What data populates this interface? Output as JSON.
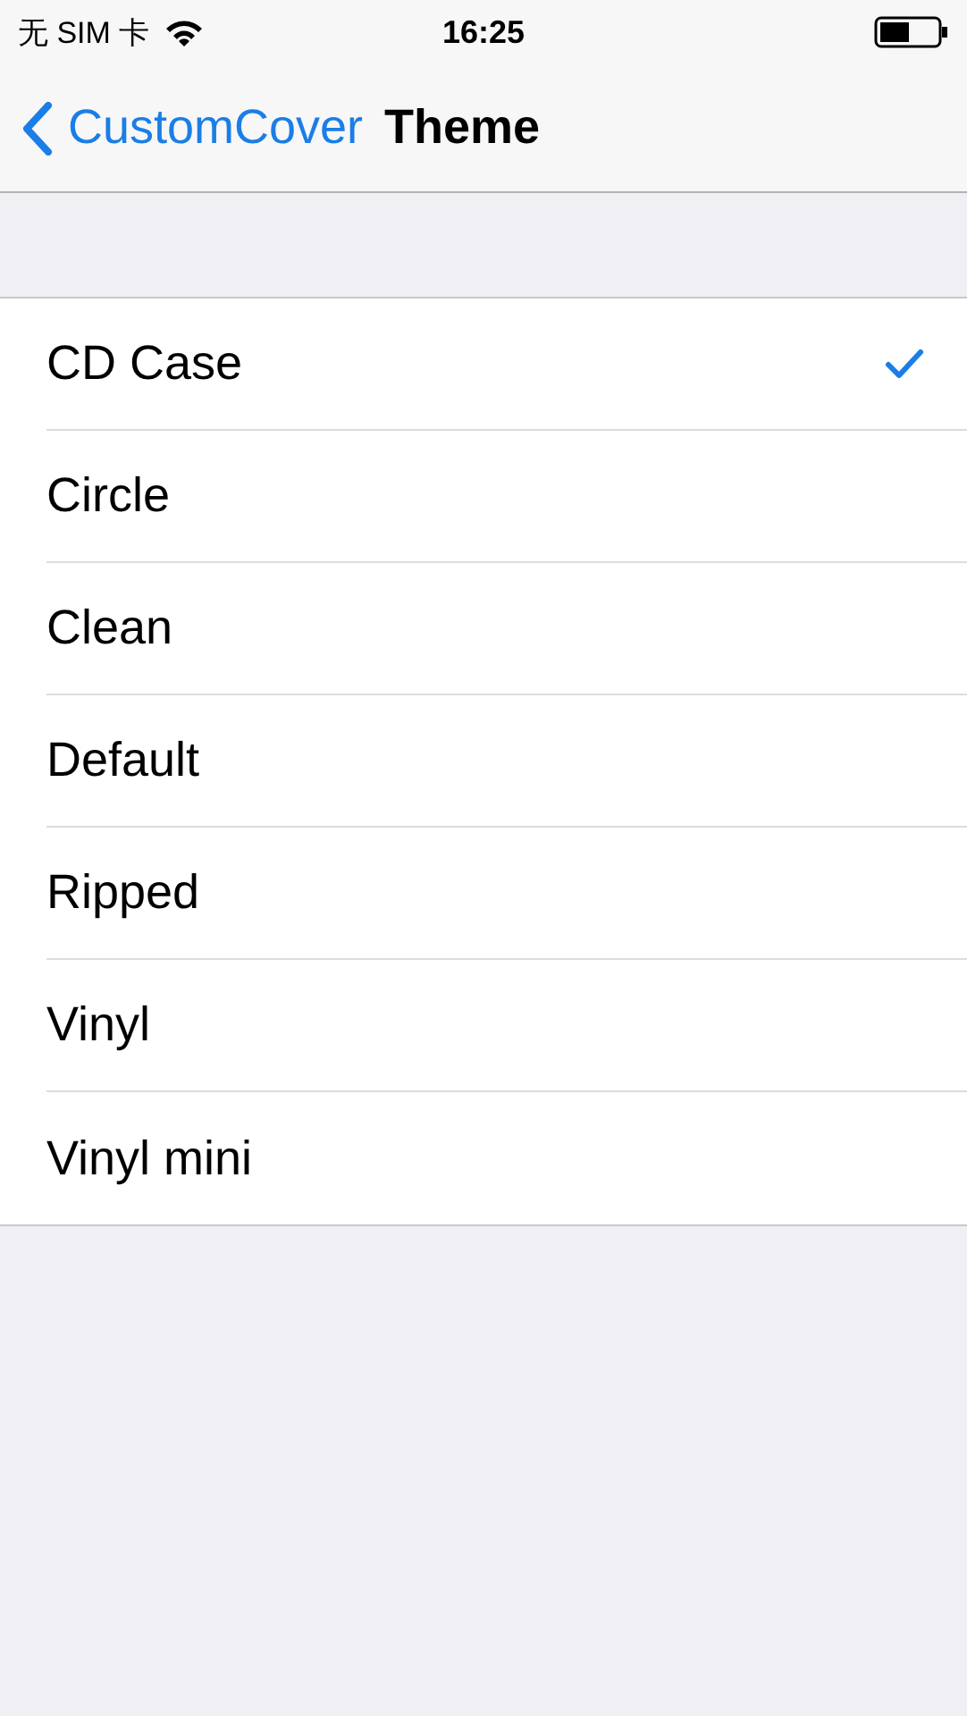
{
  "status_bar": {
    "carrier": "无 SIM 卡",
    "time": "16:25"
  },
  "nav": {
    "back": "CustomCover",
    "title": "Theme"
  },
  "options": [
    {
      "label": "CD Case",
      "selected": true
    },
    {
      "label": "Circle",
      "selected": false
    },
    {
      "label": "Clean",
      "selected": false
    },
    {
      "label": "Default",
      "selected": false
    },
    {
      "label": "Ripped",
      "selected": false
    },
    {
      "label": "Vinyl",
      "selected": false
    },
    {
      "label": "Vinyl mini",
      "selected": false
    }
  ]
}
